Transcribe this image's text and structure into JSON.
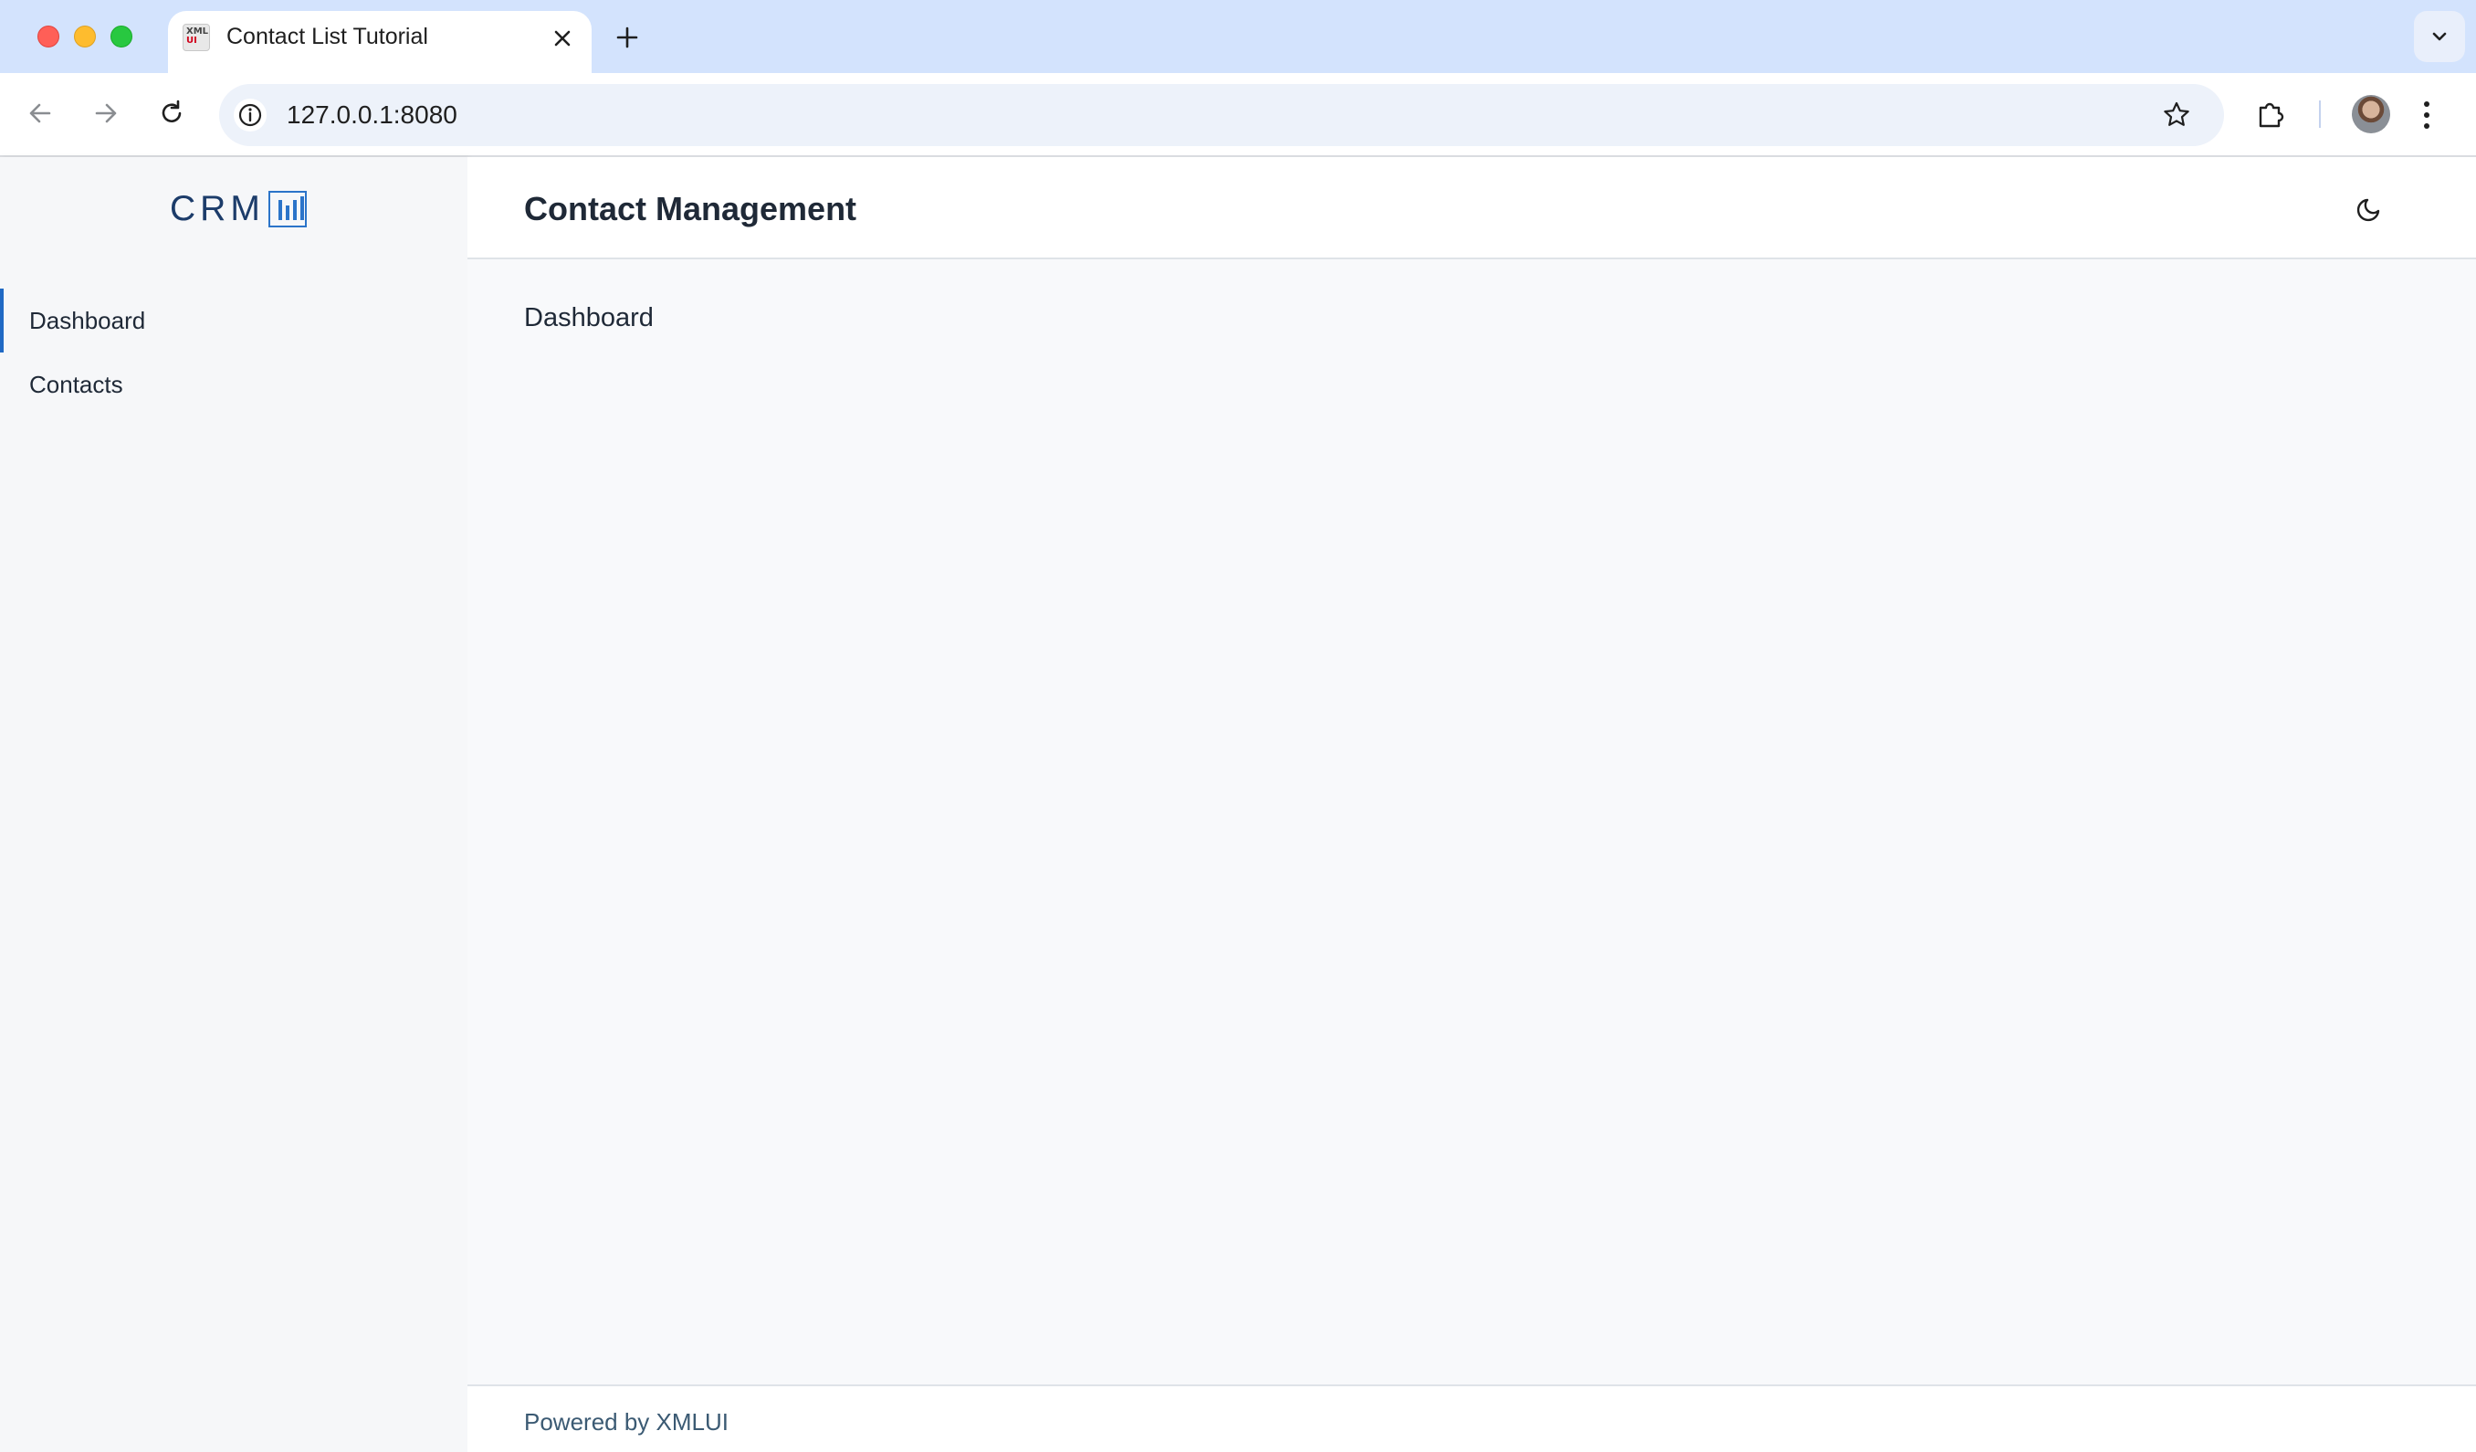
{
  "browser": {
    "tab": {
      "title": "Contact List Tutorial",
      "favicon_text_top": "XML",
      "favicon_text_bottom": "UI"
    },
    "address_bar": {
      "url": "127.0.0.1:8080"
    },
    "icons": {
      "back": "arrow-left-icon",
      "forward": "arrow-right-icon",
      "reload": "reload-icon",
      "site_info": "info-icon",
      "bookmark": "star-icon",
      "extensions": "puzzle-icon",
      "menu": "kebab-menu-icon",
      "new_tab": "plus-icon",
      "tab_search": "chevron-down-icon"
    }
  },
  "app": {
    "logo": {
      "text": "CRM"
    },
    "sidebar": {
      "items": [
        {
          "label": "Dashboard",
          "active": true
        },
        {
          "label": "Contacts",
          "active": false
        }
      ]
    },
    "header": {
      "title": "Contact Management",
      "theme_toggle_icon": "moon-icon"
    },
    "main": {
      "content": "Dashboard"
    },
    "footer": {
      "text": "Powered by XMLUI"
    },
    "colors": {
      "accent": "#2069c4",
      "sidebar_bg": "#f6f7f9",
      "main_bg": "#f8f9fb"
    }
  }
}
